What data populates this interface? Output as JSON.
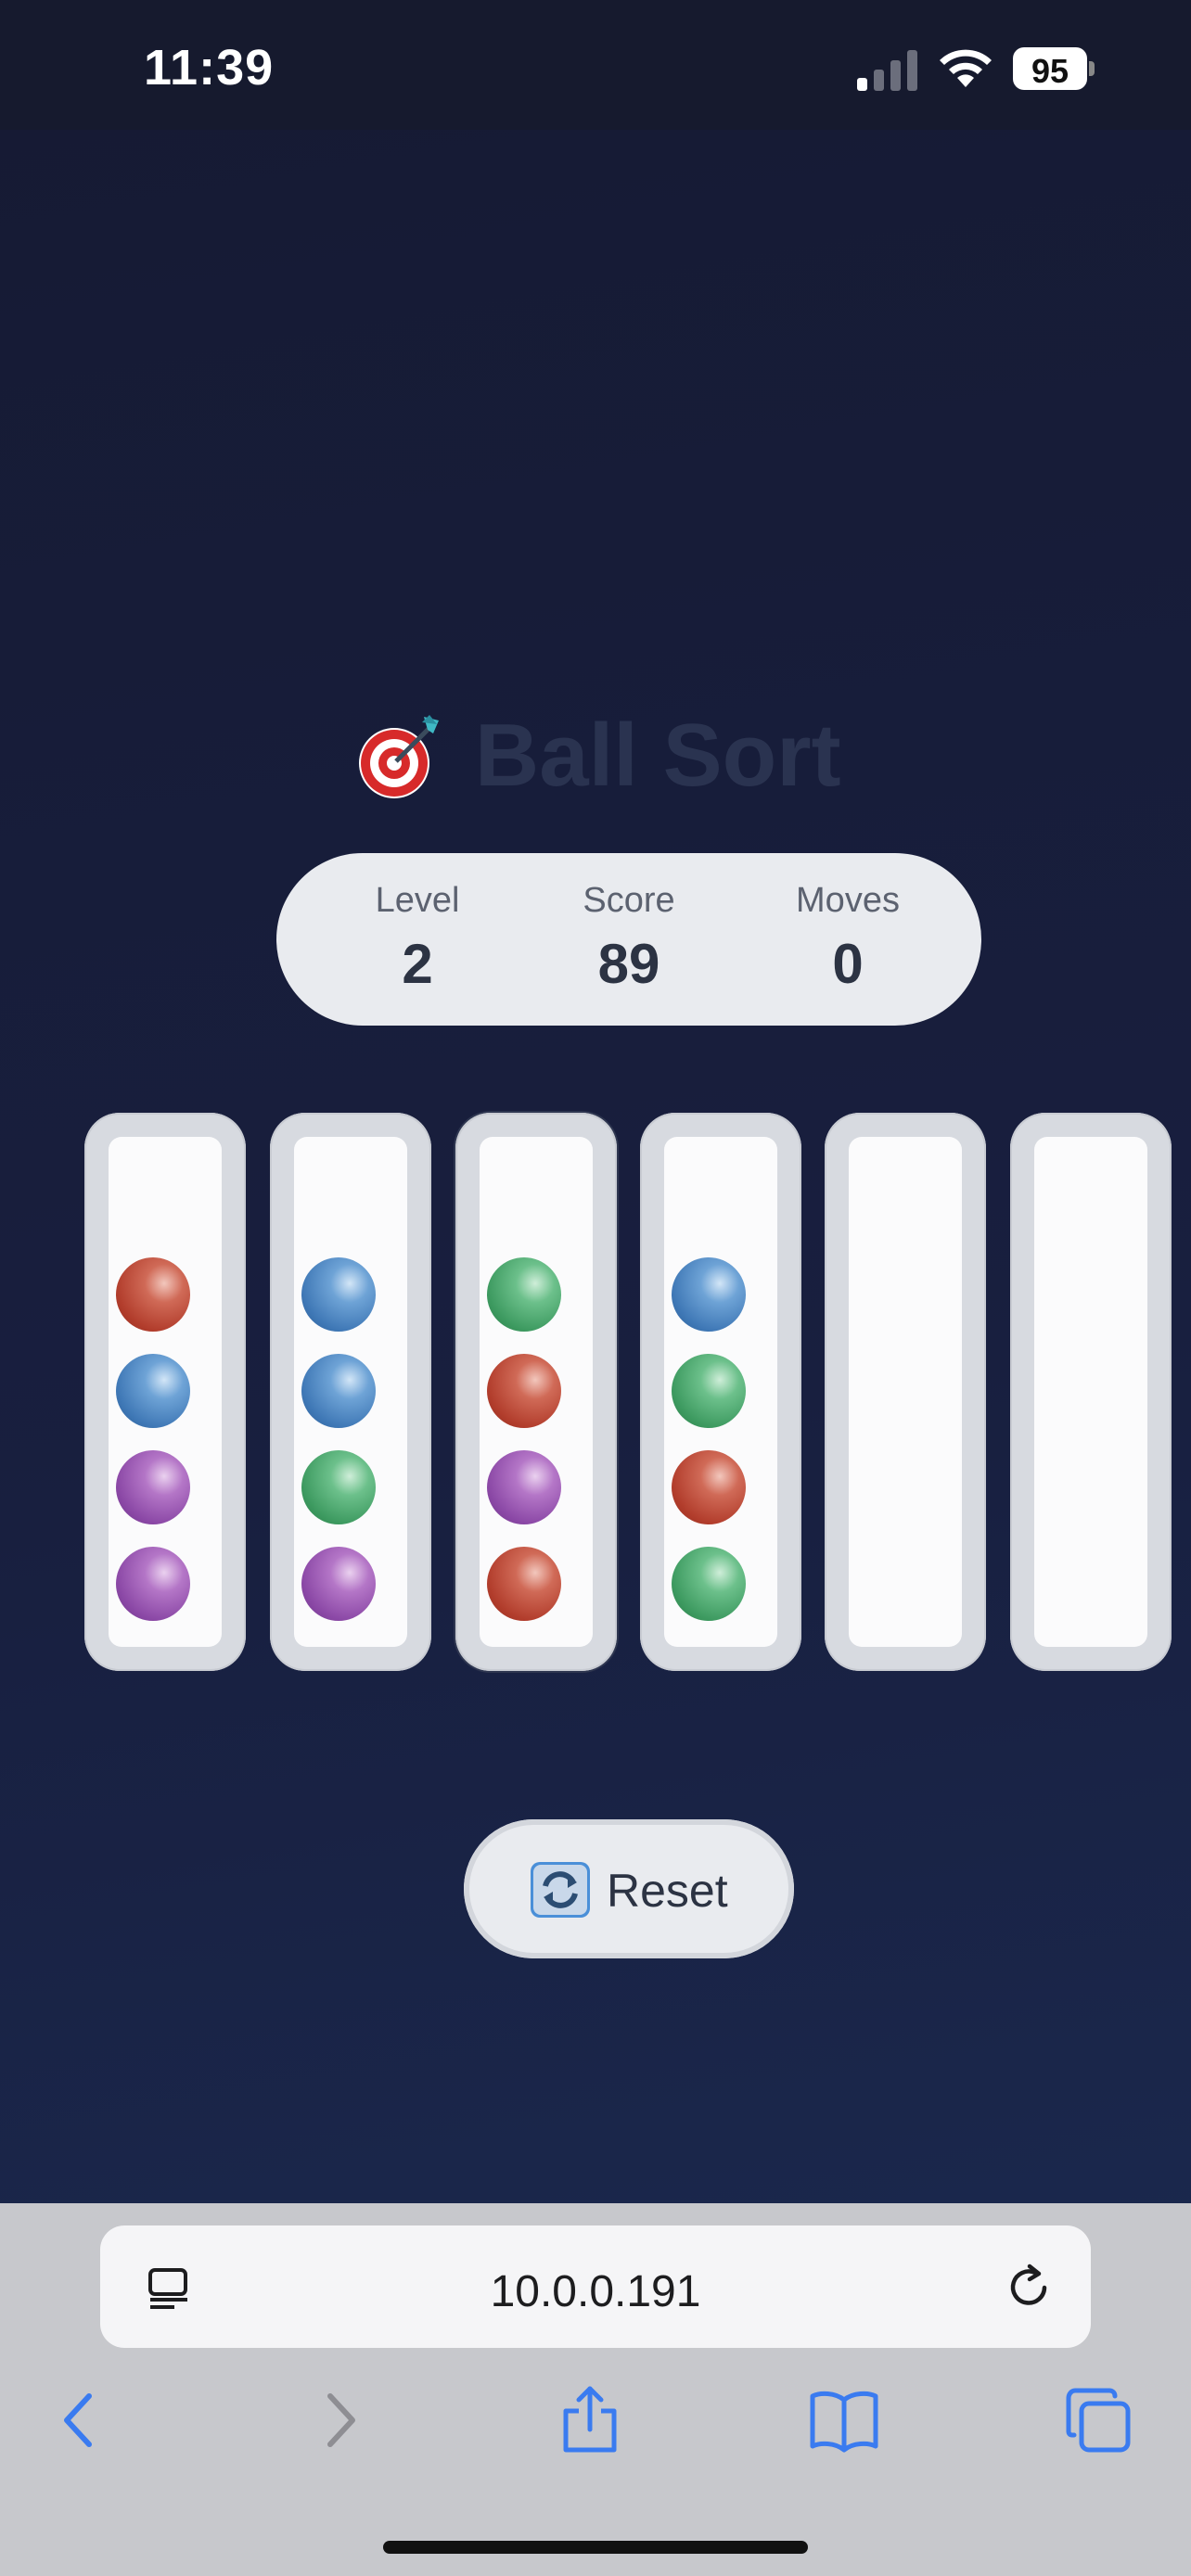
{
  "status_bar": {
    "time": "11:39",
    "battery": "95"
  },
  "game": {
    "title": "Ball Sort",
    "stats": [
      {
        "label": "Level",
        "value": "2"
      },
      {
        "label": "Score",
        "value": "89"
      },
      {
        "label": "Moves",
        "value": "0"
      }
    ],
    "tubes": [
      {
        "balls": [
          "red",
          "blue",
          "purple",
          "purple"
        ]
      },
      {
        "balls": [
          "blue",
          "blue",
          "green",
          "purple"
        ]
      },
      {
        "balls": [
          "green",
          "red",
          "purple",
          "red"
        ],
        "selected": true
      },
      {
        "balls": [
          "blue",
          "green",
          "red",
          "green"
        ]
      },
      {
        "balls": []
      },
      {
        "balls": []
      }
    ],
    "reset_label": "Reset"
  },
  "browser": {
    "url": "10.0.0.191",
    "toolbar": [
      "back-icon",
      "forward-icon",
      "share-icon",
      "bookmarks-icon",
      "tabs-icon"
    ]
  },
  "colors": {
    "red": "#b23d2c",
    "blue": "#3f78b6",
    "purple": "#8b48a6",
    "green": "#3d9a60",
    "link_blue": "#3a7bf0"
  }
}
